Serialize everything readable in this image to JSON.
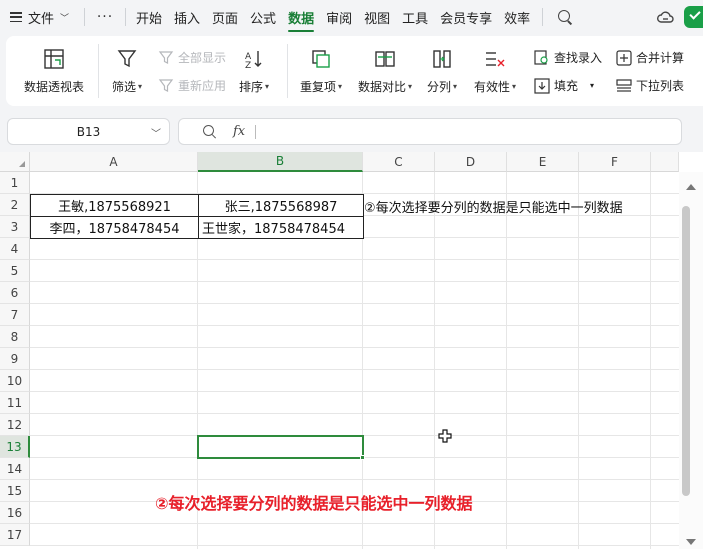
{
  "menubar": {
    "file_label": "文件",
    "more_label": "···",
    "tabs": [
      "开始",
      "插入",
      "页面",
      "公式",
      "数据",
      "审阅",
      "视图",
      "工具",
      "会员专享",
      "效率"
    ],
    "active_tab": "数据"
  },
  "ribbon": {
    "pivot": "数据透视表",
    "filter": "筛选",
    "show_all": "全部显示",
    "reapply": "重新应用",
    "sort": "排序",
    "duplicates": "重复项",
    "compare": "数据对比",
    "split": "分列",
    "validity": "有效性",
    "find_entry": "查找录入",
    "fill": "填充",
    "consolidate": "合并计算",
    "dropdown_list": "下拉列表"
  },
  "formula_bar": {
    "name_box": "B13",
    "fx": "fx",
    "value": ""
  },
  "sheet": {
    "columns": [
      "A",
      "B",
      "C",
      "D",
      "E",
      "F"
    ],
    "selected_column": "B",
    "rows": [
      "1",
      "2",
      "3",
      "4",
      "5",
      "6",
      "7",
      "8",
      "9",
      "10",
      "11",
      "12",
      "13",
      "14",
      "15",
      "16",
      "17"
    ],
    "selected_row": "13",
    "cells": {
      "A2": "王敏,1875568921",
      "B2": "张三,1875568987",
      "A3": "李四，18758478454",
      "B3": "王世家，18758478454",
      "C2": "②每次选择要分列的数据是只能选中一列数据"
    },
    "active_cell": "B13"
  },
  "caption": "②每次选择要分列的数据是只能选中一列数据",
  "colors": {
    "accent": "#1a7f37",
    "selection": "#2e8b3c",
    "caption": "#e8202a"
  }
}
